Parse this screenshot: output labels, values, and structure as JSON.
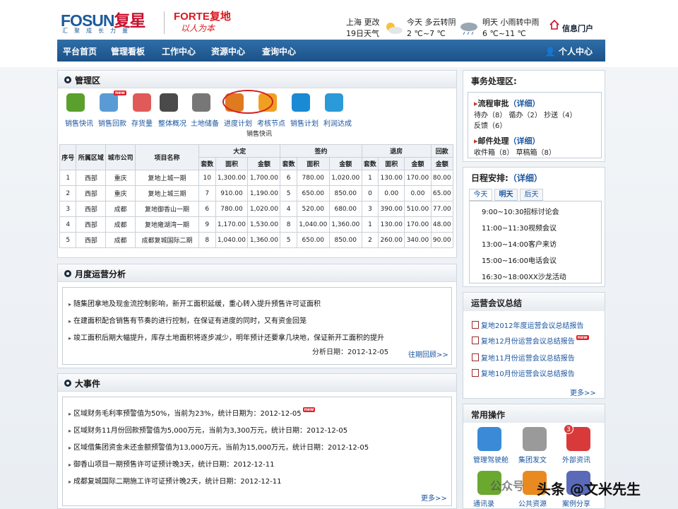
{
  "header": {
    "logo_text": "FOSUN",
    "logo_cn": "复星",
    "slogan": "汇聚成长力量",
    "logo2_text": "FORTE复地",
    "logo2_slogan": "以人为本",
    "weather": {
      "city": "上海",
      "change_link": "更改",
      "day_label": "19日天气",
      "today_label": "今天",
      "today_desc": "多云转阴",
      "today_temp": "2 ℃~7 ℃",
      "tomorrow_label": "明天",
      "tomorrow_desc": "小雨转中雨",
      "tomorrow_temp": "6 ℃~11 ℃"
    },
    "portal_label": "信息门户"
  },
  "nav": {
    "items": [
      "平台首页",
      "管理看板",
      "工作中心",
      "资源中心",
      "查询中心"
    ],
    "user_center": "个人中心"
  },
  "mgmt": {
    "title": "管理区",
    "tiles": [
      {
        "label": "销售快讯",
        "color": "#5aa02c",
        "icon": "spiral-icon"
      },
      {
        "label": "销售回款",
        "color": "#5b9bd5",
        "icon": "calculator-icon",
        "badge": "new"
      },
      {
        "label": "存货量",
        "color": "#e05a5a",
        "icon": "notebook-icon"
      },
      {
        "label": "整体概况",
        "color": "#4a4a4a",
        "icon": "chart-icon"
      },
      {
        "label": "土地储备",
        "color": "#777777",
        "icon": "door-icon"
      },
      {
        "label": "进度计划",
        "color": "#e07a20",
        "icon": "calendar-icon"
      },
      {
        "label": "考核节点",
        "color": "#f0a020",
        "icon": "checklist-icon"
      },
      {
        "label": "销售计划",
        "color": "#1a8ad4",
        "icon": "magnet-icon"
      },
      {
        "label": "利润达成",
        "color": "#2a9ad8",
        "icon": "line-chart-icon"
      }
    ],
    "table_caption": "销售快讯",
    "headers": {
      "no": "序号",
      "area": "所属区域",
      "city": "城市公司",
      "project": "项目名称",
      "g1": "大定",
      "g2": "签约",
      "g3": "退房",
      "g4": "回款",
      "sub": [
        "套数",
        "面积",
        "金额",
        "套数",
        "面积",
        "金额",
        "套数",
        "面积",
        "金额",
        "金额"
      ]
    },
    "rows": [
      [
        "1",
        "西部",
        "重庆",
        "复地上城一期",
        "10",
        "1,300.00",
        "1,700.00",
        "6",
        "780.00",
        "1,020.00",
        "1",
        "130.00",
        "170.00",
        "80.00"
      ],
      [
        "2",
        "西部",
        "重庆",
        "复地上城三期",
        "7",
        "910.00",
        "1,190.00",
        "5",
        "650.00",
        "850.00",
        "0",
        "0.00",
        "0.00",
        "65.00"
      ],
      [
        "3",
        "西部",
        "成都",
        "复地御香山一期",
        "6",
        "780.00",
        "1,020.00",
        "4",
        "520.00",
        "680.00",
        "3",
        "390.00",
        "510.00",
        "77.00"
      ],
      [
        "4",
        "西部",
        "成都",
        "复地雍湖湾一期",
        "9",
        "1,170.00",
        "1,530.00",
        "8",
        "1,040.00",
        "1,360.00",
        "1",
        "130.00",
        "170.00",
        "48.00"
      ],
      [
        "5",
        "西部",
        "成都",
        "成都复城国际二期",
        "8",
        "1,040.00",
        "1,360.00",
        "5",
        "650.00",
        "850.00",
        "2",
        "260.00",
        "340.00",
        "90.00"
      ]
    ]
  },
  "monthly": {
    "title": "月度运营分析",
    "lines": [
      "随集团拿地及现金流控制影响，新开工面积延缓，重心转入提升预售许可证面积",
      "在建面积配合销售有节奏的进行控制，在保证有进度的同时，又有资金回笼",
      "竣工面积后期大幅提升，库存土地面积将逐步减少，明年预计还要拿几块地，保证新开工面积的提升"
    ],
    "date": "分析日期：2012-12-05",
    "more": "往期回顾>>"
  },
  "events": {
    "title": "大事件",
    "lines": [
      "区域财务毛利率预警值为50%，当前为23%，统计日期为：2012-12-05",
      "区域财务11月份回款预警值为5,000万元，当前为3,300万元，统计日期：2012-12-05",
      "区域借集团资金未还金额预警值为13,000万元，当前为15,000万元，统计日期：2012-12-05",
      "御香山项目一期预售许可证预计晚3天，统计日期：2012-12-11",
      "成都复城国际二期施工许可证预计晚2天，统计日期：2012-12-11"
    ],
    "new_badge": "new",
    "more": "更多>>"
  },
  "affairs": {
    "title": "事务处理区:",
    "flow_title": "流程审批",
    "flow_link": "（详细）",
    "flow_l1": "待办（8） 循办（2） 抄送（4）",
    "flow_l2": "反馈（6）",
    "mail_title": "邮件处理",
    "mail_link": "（详细）",
    "mail_l1": "收件箱（8） 草稿箱（8）"
  },
  "schedule": {
    "title": "日程安排:",
    "link": "（详细）",
    "tabs": [
      "今天",
      "明天",
      "后天"
    ],
    "items": [
      "9:00~10:30招标讨论会",
      "11:00~11:30视频会议",
      "13:00~14:00客户来访",
      "15:00~16:00电话会议",
      "16:30~18:00XX沙龙活动"
    ]
  },
  "reports": {
    "title": "运营会议总结",
    "items": [
      "复地2012年度运营会议总结报告",
      "复地12月份运营会议总结报告",
      "复地11月份运营会议总结报告",
      "复地10月份运营会议总结报告"
    ],
    "new_badge": "new",
    "more": "更多>>"
  },
  "ops": {
    "title": "常用操作",
    "items": [
      {
        "label": "管理驾驶舱",
        "color": "#3a8ad8",
        "icon": "dashboard-icon"
      },
      {
        "label": "集团发文",
        "color": "#9a9a9a",
        "icon": "document-icon"
      },
      {
        "label": "外部资讯",
        "color": "#d83a3a",
        "icon": "news-icon",
        "badge": "3"
      },
      {
        "label": "通讯录",
        "color": "#6aa830",
        "icon": "contacts-icon"
      },
      {
        "label": "公共资源",
        "color": "#e88a20",
        "icon": "folder-icon"
      },
      {
        "label": "案例分享",
        "color": "#5a6ab8",
        "icon": "share-icon"
      }
    ]
  },
  "watermark": {
    "text1": "公众号",
    "text2": "头条 @文米先生"
  }
}
